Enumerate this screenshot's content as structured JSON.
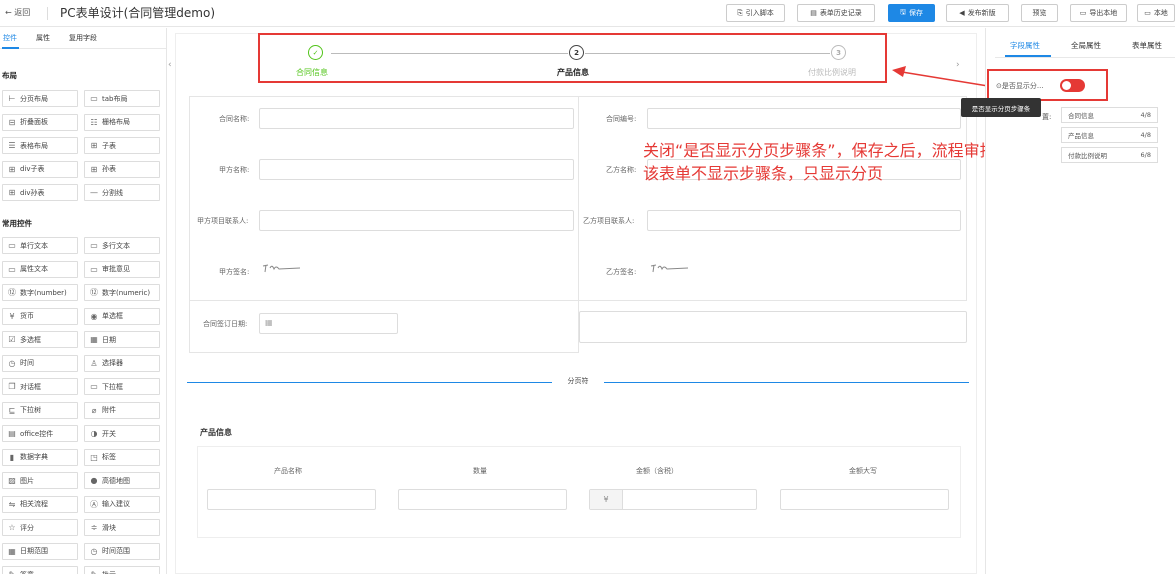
{
  "header": {
    "back_label": "返回",
    "title": "PC表单设计(合同管理demo)",
    "buttons": {
      "import": "引入脚本",
      "history": "表单历史记录",
      "save": "保存",
      "publish": "发布新版",
      "preview": "预览",
      "export": "导出本地",
      "local": "本地"
    }
  },
  "left_panel": {
    "tabs": [
      "控件",
      "属性",
      "复用字段"
    ],
    "layout_title": "布局",
    "layout_items": [
      {
        "label": "分页布局",
        "icon": "page-layout-icon",
        "glyph": "⊢"
      },
      {
        "label": "tab布局",
        "icon": "tab-layout-icon",
        "glyph": "▭"
      },
      {
        "label": "折叠面板",
        "icon": "collapse-panel-icon",
        "glyph": "⊟"
      },
      {
        "label": "栅格布局",
        "icon": "grid-layout-icon",
        "glyph": "☷"
      },
      {
        "label": "表格布局",
        "icon": "table-layout-icon",
        "glyph": "☰"
      },
      {
        "label": "子表",
        "icon": "subtable-icon",
        "glyph": "⊞"
      },
      {
        "label": "div子表",
        "icon": "div-subtable-icon",
        "glyph": "⊞"
      },
      {
        "label": "孙表",
        "icon": "grandchild-table-icon",
        "glyph": "⊞"
      },
      {
        "label": "div孙表",
        "icon": "div-grandchild-table-icon",
        "glyph": "⊞"
      },
      {
        "label": "分割线",
        "icon": "divider-icon",
        "glyph": "—"
      }
    ],
    "common_title": "常用控件",
    "common_items": [
      {
        "label": "单行文本",
        "icon": "single-line-text-icon",
        "glyph": "▭"
      },
      {
        "label": "多行文本",
        "icon": "multi-line-text-icon",
        "glyph": "▭"
      },
      {
        "label": "属性文本",
        "icon": "attribute-text-icon",
        "glyph": "▭"
      },
      {
        "label": "审批意见",
        "icon": "approval-opinion-icon",
        "glyph": "▭"
      },
      {
        "label": "数字(number)",
        "icon": "number-icon",
        "glyph": "⑫"
      },
      {
        "label": "数字(numeric)",
        "icon": "numeric-icon",
        "glyph": "⑫"
      },
      {
        "label": "货币",
        "icon": "currency-icon",
        "glyph": "¥"
      },
      {
        "label": "单选框",
        "icon": "radio-icon",
        "glyph": "◉"
      },
      {
        "label": "多选框",
        "icon": "checkbox-icon",
        "glyph": "☑"
      },
      {
        "label": "日期",
        "icon": "date-icon",
        "glyph": "▦"
      },
      {
        "label": "时间",
        "icon": "time-icon",
        "glyph": "◷"
      },
      {
        "label": "选择器",
        "icon": "selector-icon",
        "glyph": "♙"
      },
      {
        "label": "对话框",
        "icon": "dialog-icon",
        "glyph": "❐"
      },
      {
        "label": "下拉框",
        "icon": "dropdown-icon",
        "glyph": "▭"
      },
      {
        "label": "下拉树",
        "icon": "dropdown-tree-icon",
        "glyph": "⊑"
      },
      {
        "label": "附件",
        "icon": "attachment-icon",
        "glyph": "⌀"
      },
      {
        "label": "office控件",
        "icon": "office-icon",
        "glyph": "▤"
      },
      {
        "label": "开关",
        "icon": "switch-icon",
        "glyph": "◑"
      },
      {
        "label": "数据字典",
        "icon": "data-dictionary-icon",
        "glyph": "▮"
      },
      {
        "label": "标签",
        "icon": "tag-icon",
        "glyph": "◳"
      },
      {
        "label": "图片",
        "icon": "image-icon",
        "glyph": "▨"
      },
      {
        "label": "高德地图",
        "icon": "map-pin-icon",
        "glyph": "●"
      },
      {
        "label": "相关流程",
        "icon": "related-process-icon",
        "glyph": "⇋"
      },
      {
        "label": "输入建议",
        "icon": "input-suggestion-icon",
        "glyph": "Ⓐ"
      },
      {
        "label": "评分",
        "icon": "rating-star-icon",
        "glyph": "☆"
      },
      {
        "label": "滑块",
        "icon": "slider-icon",
        "glyph": "≑"
      },
      {
        "label": "日期范围",
        "icon": "date-range-icon",
        "glyph": "▦"
      },
      {
        "label": "时间范围",
        "icon": "time-range-icon",
        "glyph": "◷"
      },
      {
        "label": "签章",
        "icon": "seal-icon",
        "glyph": "✎"
      },
      {
        "label": "批示",
        "icon": "instruction-icon",
        "glyph": "✎"
      }
    ]
  },
  "steps": [
    {
      "label": "合同信息",
      "status": "done",
      "number": ""
    },
    {
      "label": "产品信息",
      "status": "current",
      "number": "2"
    },
    {
      "label": "付款比例说明",
      "status": "pending",
      "number": "3"
    }
  ],
  "form_fields": {
    "contract_name": "合同名称:",
    "contract_no": "合同编号:",
    "party_a_name": "甲方名称:",
    "party_b_name": "乙方名称:",
    "party_a_contact": "甲方项目联系人:",
    "party_b_contact": "乙方项目联系人:",
    "party_a_sign": "甲方签名:",
    "party_b_sign": "乙方签名:",
    "sign_date": "合同签订日期:"
  },
  "page_break_label": "分页符",
  "product_section": {
    "title": "产品信息",
    "columns": [
      "产品名称",
      "数量",
      "金额（含税）",
      "金额大写"
    ],
    "currency_symbol": "¥"
  },
  "annotation": {
    "line1": "关闭“是否显示分页步骤条”，保存之后，流程审批",
    "line2": "该表单不显示步骤条，只显示分页"
  },
  "right_panel": {
    "tabs": [
      "字段属性",
      "全局属性",
      "表单属性"
    ],
    "show_steps_label": "是否显示分...",
    "show_steps_toggle": "on",
    "tooltip": "是否显示分页步骤条",
    "order_label": "置:",
    "step_items": [
      {
        "label": "合同信息",
        "count": "4/8"
      },
      {
        "label": "产品信息",
        "count": "4/8"
      },
      {
        "label": "付款比例说明",
        "count": "6/8"
      }
    ]
  },
  "colors": {
    "accent": "#1e88e5",
    "success": "#52c41a",
    "annotation_red": "#e53935"
  }
}
